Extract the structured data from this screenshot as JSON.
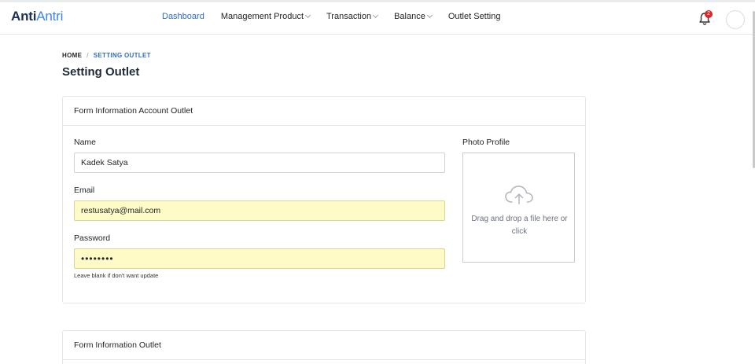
{
  "brand": {
    "part1": "Anti",
    "part2": "Antri"
  },
  "nav": {
    "items": [
      {
        "label": "Dashboard",
        "active": true,
        "dropdown": false
      },
      {
        "label": "Management Product",
        "active": false,
        "dropdown": true
      },
      {
        "label": "Transaction",
        "active": false,
        "dropdown": true
      },
      {
        "label": "Balance",
        "active": false,
        "dropdown": true
      },
      {
        "label": "Outlet Setting",
        "active": false,
        "dropdown": false
      }
    ],
    "notification_count": "2"
  },
  "breadcrumb": {
    "home": "HOME",
    "separator": "/",
    "current": "SETTING OUTLET"
  },
  "page_title": "Setting Outlet",
  "account_card": {
    "title": "Form Information Account Outlet",
    "name_label": "Name",
    "name_value": "Kadek Satya",
    "email_label": "Email",
    "email_value": "restusatya@mail.com",
    "password_label": "Password",
    "password_value": "••••••••",
    "password_help": "Leave blank if don't want update",
    "photo_label": "Photo Profile",
    "dropzone_text": "Drag and drop a file here or click"
  },
  "outlet_card": {
    "title": "Form Information Outlet"
  },
  "colors": {
    "accent": "#2f6cc4",
    "brand_dark": "#1a2f5a",
    "autofill": "#fefbc7",
    "badge": "#dc2626"
  }
}
